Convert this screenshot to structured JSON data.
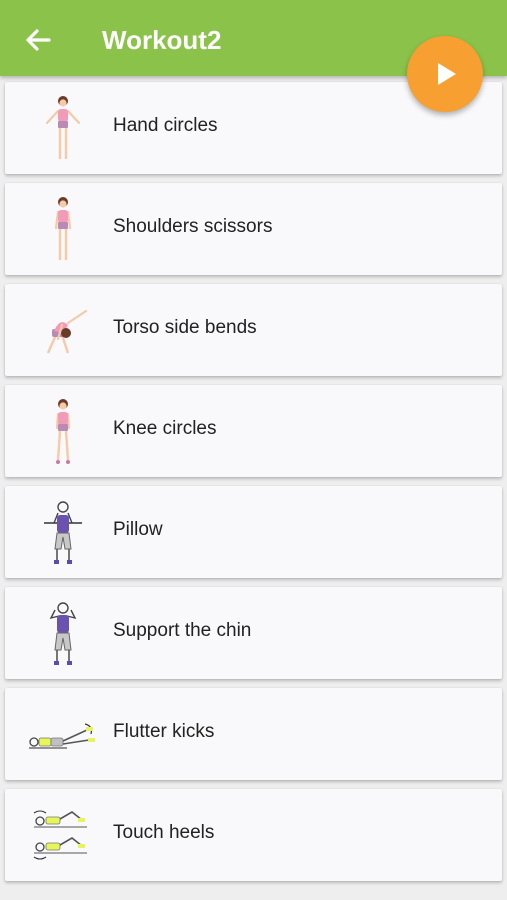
{
  "header": {
    "title": "Workout2",
    "back_icon": "arrow-back-icon",
    "play_icon": "play-icon"
  },
  "colors": {
    "appbar": "#8bc34a",
    "fab": "#f79f30",
    "card": "#f9f9fb"
  },
  "exercises": [
    {
      "label": "Hand circles",
      "icon": "woman-standing-figure"
    },
    {
      "label": "Shoulders scissors",
      "icon": "woman-standing-figure"
    },
    {
      "label": "Torso side bends",
      "icon": "woman-bending-figure"
    },
    {
      "label": "Knee circles",
      "icon": "woman-standing-figure"
    },
    {
      "label": "Pillow",
      "icon": "pillow-figure"
    },
    {
      "label": "Support the chin",
      "icon": "chin-support-figure"
    },
    {
      "label": "Flutter kicks",
      "icon": "flutter-kicks-figure"
    },
    {
      "label": "Touch heels",
      "icon": "touch-heels-figure"
    }
  ]
}
